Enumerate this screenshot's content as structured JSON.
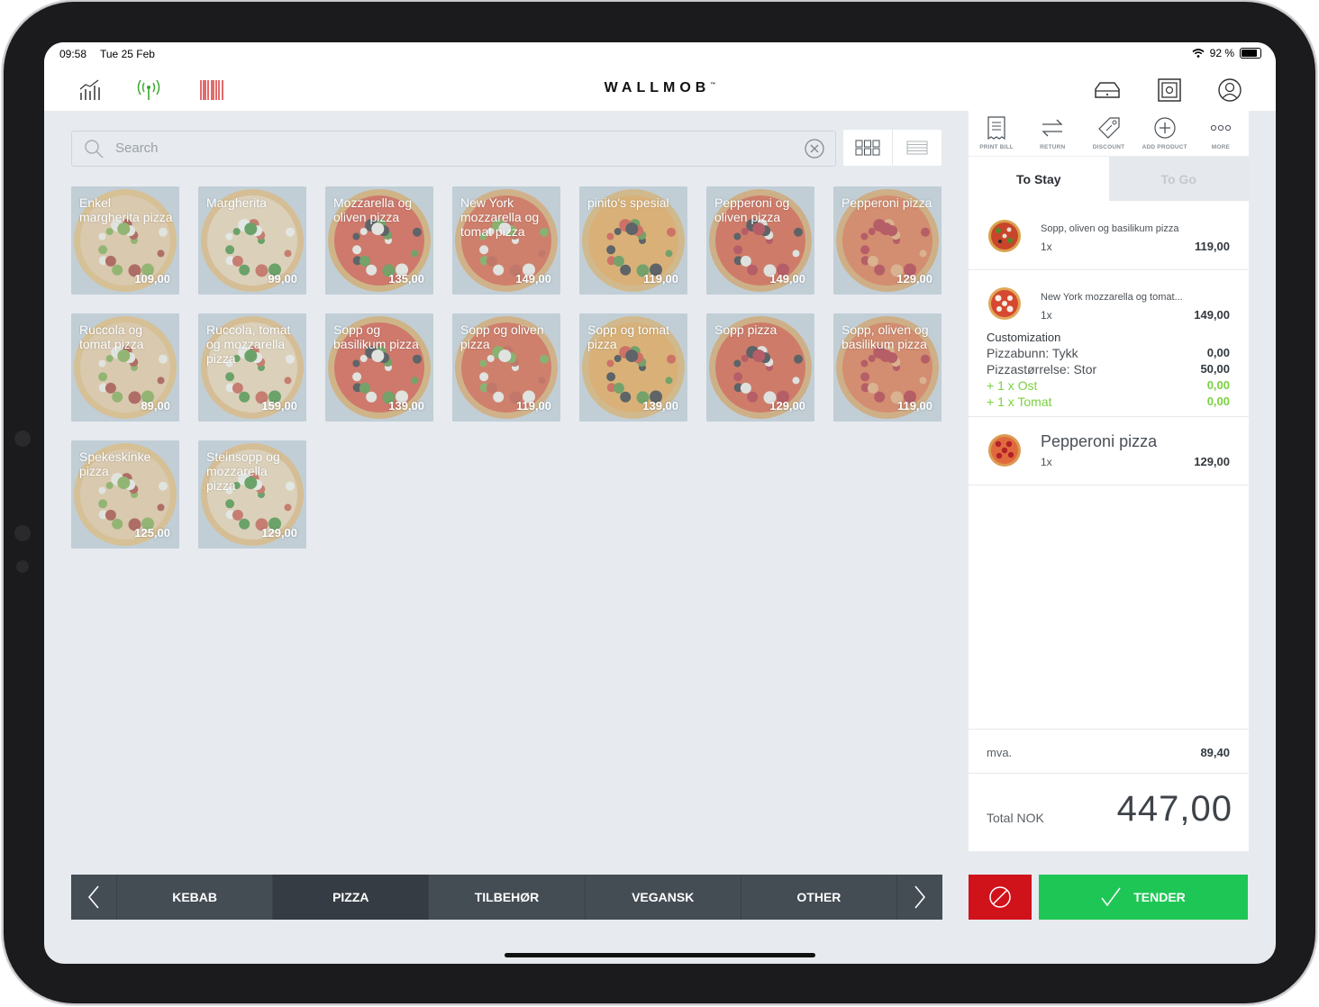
{
  "statusbar": {
    "time": "09:58",
    "date": "Tue 25 Feb",
    "battery": "92 %",
    "battery_level": 0.92
  },
  "header": {
    "brand": "WALLMOB",
    "left_icons": [
      "stats-icon",
      "wifi-signal-icon",
      "barcode-icon"
    ],
    "right_icons": [
      "drawer-icon",
      "safe-icon",
      "user-icon"
    ],
    "colors": {
      "signal": "#3aa82f",
      "barcode": "#d52b2b"
    }
  },
  "search": {
    "placeholder": "Search",
    "value": ""
  },
  "products": [
    {
      "name": "Enkel margherita pizza",
      "price": "109,00"
    },
    {
      "name": "Margherita",
      "price": "99,00"
    },
    {
      "name": "Mozzarella og oliven pizza",
      "price": "135,00"
    },
    {
      "name": "New York mozzarella og tomat pizza",
      "price": "149,00"
    },
    {
      "name": "pinito's spesial",
      "price": "119,00"
    },
    {
      "name": "Pepperoni og oliven pizza",
      "price": "149,00"
    },
    {
      "name": "Pepperoni pizza",
      "price": "129,00"
    },
    {
      "name": "Ruccola og tomat pizza",
      "price": "89,00"
    },
    {
      "name": "Ruccola, tomat og mozzarella pizza",
      "price": "159,00"
    },
    {
      "name": "Sopp og basilikum pizza",
      "price": "139,00"
    },
    {
      "name": "Sopp og oliven pizza",
      "price": "119,00"
    },
    {
      "name": "Sopp og tomat pizza",
      "price": "139,00"
    },
    {
      "name": "Sopp pizza",
      "price": "129,00"
    },
    {
      "name": "Sopp, oliven og basilikum pizza",
      "price": "119,00"
    },
    {
      "name": "Spekeskinke pizza",
      "price": "125,00"
    },
    {
      "name": "Steinsopp og mozzarella pizza",
      "price": "129,00"
    }
  ],
  "categories": {
    "items": [
      "KEBAB",
      "PIZZA",
      "TILBEHØR",
      "VEGANSK",
      "OTHER"
    ],
    "active": "PIZZA"
  },
  "actions": [
    "PRINT BILL",
    "RETURN",
    "DISCOUNT",
    "ADD PRODUCT",
    "MORE"
  ],
  "order_tabs": {
    "stay": "To Stay",
    "go": "To Go",
    "active": "To Stay"
  },
  "order": {
    "lines": [
      {
        "name": "Sopp, oliven og basilikum pizza",
        "qty": "1x",
        "price": "119,00"
      },
      {
        "name": "New York mozzarella og tomat...",
        "qty": "1x",
        "price": "149,00"
      },
      {
        "name": "Pepperoni pizza",
        "qty": "1x",
        "price": "129,00"
      }
    ],
    "customization": {
      "title": "Customization",
      "rows": [
        {
          "label": "Pizzabunn: Tykk",
          "value": "0,00"
        },
        {
          "label": "Pizzastørrelse: Stor",
          "value": "50,00"
        },
        {
          "label": "+ 1 x Ost",
          "value": "0,00"
        },
        {
          "label": "+ 1 x Tomat",
          "value": "0,00"
        }
      ]
    },
    "tax_label": "mva.",
    "tax_value": "89,40",
    "total_label": "Total NOK",
    "total_value": "447,00"
  },
  "buttons": {
    "tender": "TENDER",
    "void_icon": "no-sign-icon"
  },
  "colors": {
    "tender": "#1ec755",
    "void": "#d0121b",
    "category_bar": "#444c54",
    "addon_text": "#7bd13f"
  }
}
